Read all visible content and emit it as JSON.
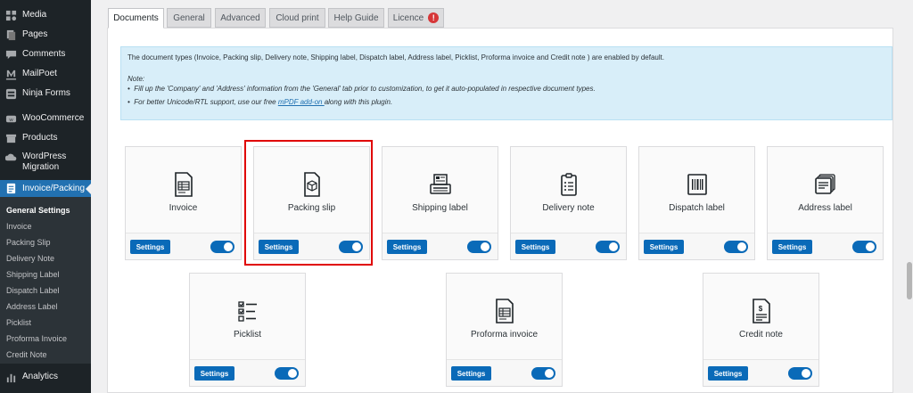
{
  "sidebar": {
    "menu": [
      {
        "label": "Media",
        "icon": "media-icon"
      },
      {
        "label": "Pages",
        "icon": "pages-icon"
      },
      {
        "label": "Comments",
        "icon": "comments-icon"
      },
      {
        "label": "MailPoet",
        "icon": "mailpoet-icon"
      },
      {
        "label": "Ninja Forms",
        "icon": "ninja-forms-icon"
      },
      {
        "label": "WooCommerce",
        "icon": "woocommerce-icon"
      },
      {
        "label": "Products",
        "icon": "products-icon"
      },
      {
        "label": "WordPress",
        "label2": "Migration",
        "icon": "migration-icon"
      },
      {
        "label": "Invoice/Packing",
        "icon": "invoice-packing-icon"
      }
    ],
    "submenu": [
      "General Settings",
      "Invoice",
      "Packing Slip",
      "Delivery Note",
      "Shipping Label",
      "Dispatch Label",
      "Address Label",
      "Picklist",
      "Proforma Invoice",
      "Credit Note"
    ],
    "bottom": {
      "label": "Analytics",
      "icon": "analytics-icon"
    }
  },
  "tabs": [
    "Documents",
    "General",
    "Advanced",
    "Cloud print",
    "Help Guide",
    "Licence"
  ],
  "licence_badge": "!",
  "notice": {
    "line1": "The document types (Invoice, Packing slip, Delivery note, Shipping label, Dispatch label, Address label, Picklist, Proforma invoice and Credit note ) are enabled by default.",
    "note_label": "Note:",
    "bullet1": "Fill up the 'Company' and 'Address' information from the 'General' tab prior to customization, to get it auto-populated in respective document types.",
    "bullet2_pre": "For better Unicode/RTL support, use our free ",
    "bullet2_link": "mPDF add-on ",
    "bullet2_post": "along with this plugin."
  },
  "settings_label": "Settings",
  "cards": [
    {
      "title": "Invoice",
      "icon": "invoice-icon",
      "enabled": true
    },
    {
      "title": "Packing slip",
      "icon": "packing-slip-icon",
      "enabled": true
    },
    {
      "title": "Shipping label",
      "icon": "shipping-label-icon",
      "enabled": true
    },
    {
      "title": "Delivery note",
      "icon": "delivery-note-icon",
      "enabled": true
    },
    {
      "title": "Dispatch label",
      "icon": "dispatch-label-icon",
      "enabled": true
    },
    {
      "title": "Address label",
      "icon": "address-label-icon",
      "enabled": true
    },
    {
      "title": "Picklist",
      "icon": "picklist-icon",
      "enabled": true
    },
    {
      "title": "Proforma invoice",
      "icon": "proforma-invoice-icon",
      "enabled": true
    },
    {
      "title": "Credit note",
      "icon": "credit-note-icon",
      "enabled": true
    }
  ],
  "colors": {
    "sidebar": "#1d2327",
    "accent": "#2271b1",
    "button": "#0a6ab8",
    "highlight": "#e00000",
    "notice": "#d8eef9"
  }
}
